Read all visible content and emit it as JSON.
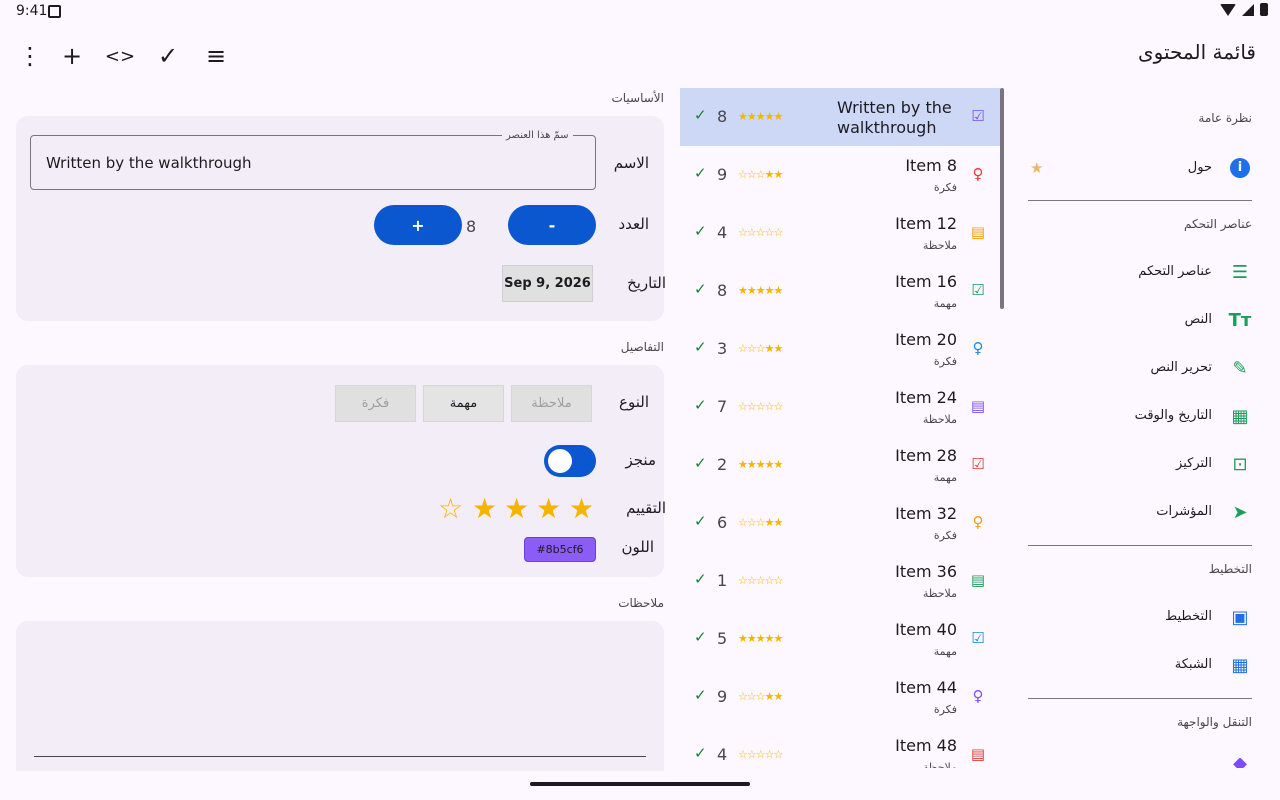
{
  "status": {
    "time": "9:41"
  },
  "app_title": "قائمة المحتوى",
  "toolbar": {
    "more": "⋮",
    "add": "+",
    "code": "<>",
    "check": "✓",
    "filter": "≡"
  },
  "basics": {
    "section_label": "الأساسيات",
    "name_label": "الاسم",
    "name_field_label": "سمّ هذا العنصر",
    "name_value": "Written by the walkthrough",
    "count_label": "العدد",
    "decrement": "-",
    "increment": "+",
    "count_value": "8",
    "date_label": "التاريخ",
    "date_value": "Sep 9, 2026"
  },
  "details": {
    "section_label": "التفاصيل",
    "type_label": "النوع",
    "type_options": [
      "ملاحظة",
      "مهمة",
      "فكرة"
    ],
    "type_selected": "مهمة",
    "done_label": "منجز",
    "done": true,
    "rating_label": "التقييم",
    "rating": 4,
    "rating_max": 5,
    "color_label": "اللون",
    "color_value": "#8b5cf6"
  },
  "notes": {
    "section_label": "ملاحظات"
  },
  "list": {
    "items": [
      {
        "title": "Written by the walkthrough",
        "subtitle": "",
        "num": "8",
        "stars": "★★★★★",
        "icon": "☑",
        "icon_color": "#7c4dff",
        "selected": true
      },
      {
        "title": "Item 8",
        "subtitle": "فكرة",
        "num": "9",
        "stars": "☆☆☆★★",
        "icon": "♀",
        "icon_color": "#e53935"
      },
      {
        "title": "Item 12",
        "subtitle": "ملاحظة",
        "num": "4",
        "stars": "☆☆☆☆☆",
        "icon": "▤",
        "icon_color": "#f59e0b"
      },
      {
        "title": "Item 16",
        "subtitle": "مهمة",
        "num": "8",
        "stars": "★★★★★",
        "icon": "☑",
        "icon_color": "#1a9f5b"
      },
      {
        "title": "Item 20",
        "subtitle": "فكرة",
        "num": "3",
        "stars": "☆☆☆★★",
        "icon": "♀",
        "icon_color": "#1e88e5"
      },
      {
        "title": "Item 24",
        "subtitle": "ملاحظة",
        "num": "7",
        "stars": "☆☆☆☆☆",
        "icon": "▤",
        "icon_color": "#7c4dff"
      },
      {
        "title": "Item 28",
        "subtitle": "مهمة",
        "num": "2",
        "stars": "★★★★★",
        "icon": "☑",
        "icon_color": "#e53935"
      },
      {
        "title": "Item 32",
        "subtitle": "فكرة",
        "num": "6",
        "stars": "☆☆☆★★",
        "icon": "♀",
        "icon_color": "#f59e0b"
      },
      {
        "title": "Item 36",
        "subtitle": "ملاحظة",
        "num": "1",
        "stars": "☆☆☆☆☆",
        "icon": "▤",
        "icon_color": "#1a9f5b"
      },
      {
        "title": "Item 40",
        "subtitle": "مهمة",
        "num": "5",
        "stars": "★★★★★",
        "icon": "☑",
        "icon_color": "#1e88e5"
      },
      {
        "title": "Item 44",
        "subtitle": "فكرة",
        "num": "9",
        "stars": "☆☆☆★★",
        "icon": "♀",
        "icon_color": "#7c4dff"
      },
      {
        "title": "Item 48",
        "subtitle": "ملاحظة",
        "num": "4",
        "stars": "☆☆☆☆☆",
        "icon": "▤",
        "icon_color": "#e53935"
      }
    ]
  },
  "nav": {
    "overview": {
      "header": "نظرة عامة",
      "about": "حول"
    },
    "controls": {
      "header": "عناصر التحكم",
      "items": [
        "عناصر التحكم",
        "النص",
        "تحرير النص",
        "التاريخ والوقت",
        "التركيز",
        "المؤشرات"
      ]
    },
    "layout": {
      "header": "التخطيط",
      "items": [
        "التخطيط",
        "الشبكة"
      ]
    },
    "navigation": {
      "header": "التنقل والواجهة"
    }
  },
  "colors": {
    "primary": "#0b57d0",
    "selected_row": "#cdd8f6",
    "star": "#f4b400",
    "background": "#fdf7ff",
    "card": "#f3edf7"
  }
}
